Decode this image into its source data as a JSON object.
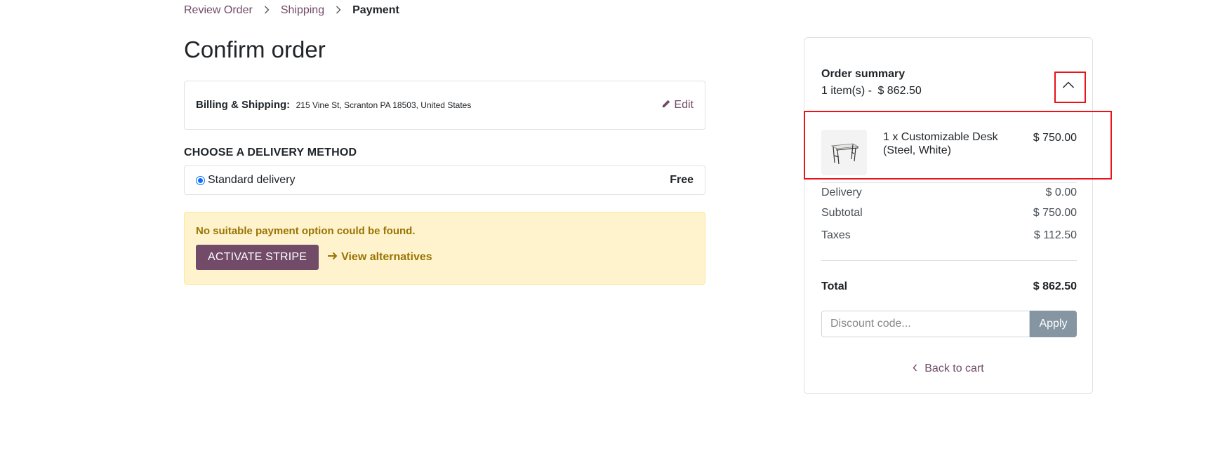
{
  "breadcrumb": {
    "items": [
      {
        "label": "Review Order"
      },
      {
        "label": "Shipping"
      },
      {
        "label": "Payment"
      }
    ]
  },
  "page_title": "Confirm order",
  "billing": {
    "label": "Billing & Shipping:",
    "address": "215 Vine St, Scranton PA 18503, United States",
    "edit_label": "Edit"
  },
  "delivery": {
    "heading": "CHOOSE A DELIVERY METHOD",
    "method_label": "Standard delivery",
    "method_price": "Free"
  },
  "payment_warning": {
    "message": "No suitable payment option could be found.",
    "activate_label": "ACTIVATE STRIPE",
    "alternatives_label": "View alternatives"
  },
  "summary": {
    "title": "Order summary",
    "items_count": "1 item(s) -",
    "items_total": "$ 862.50",
    "item": {
      "name": "1 x Customizable Desk (Steel, White)",
      "price": "$ 750.00"
    },
    "delivery_label": "Delivery",
    "delivery_value": "$ 0.00",
    "subtotal_label": "Subtotal",
    "subtotal_value": "$ 750.00",
    "taxes_label": "Taxes",
    "taxes_value": "$ 112.50",
    "total_label": "Total",
    "total_value": "$ 862.50",
    "discount_placeholder": "Discount code...",
    "apply_label": "Apply",
    "back_label": "Back to cart"
  },
  "colors": {
    "brand": "#714B67",
    "warning_bg": "#fff3cd",
    "warning_text": "#997404",
    "highlight": "#e8141a"
  }
}
